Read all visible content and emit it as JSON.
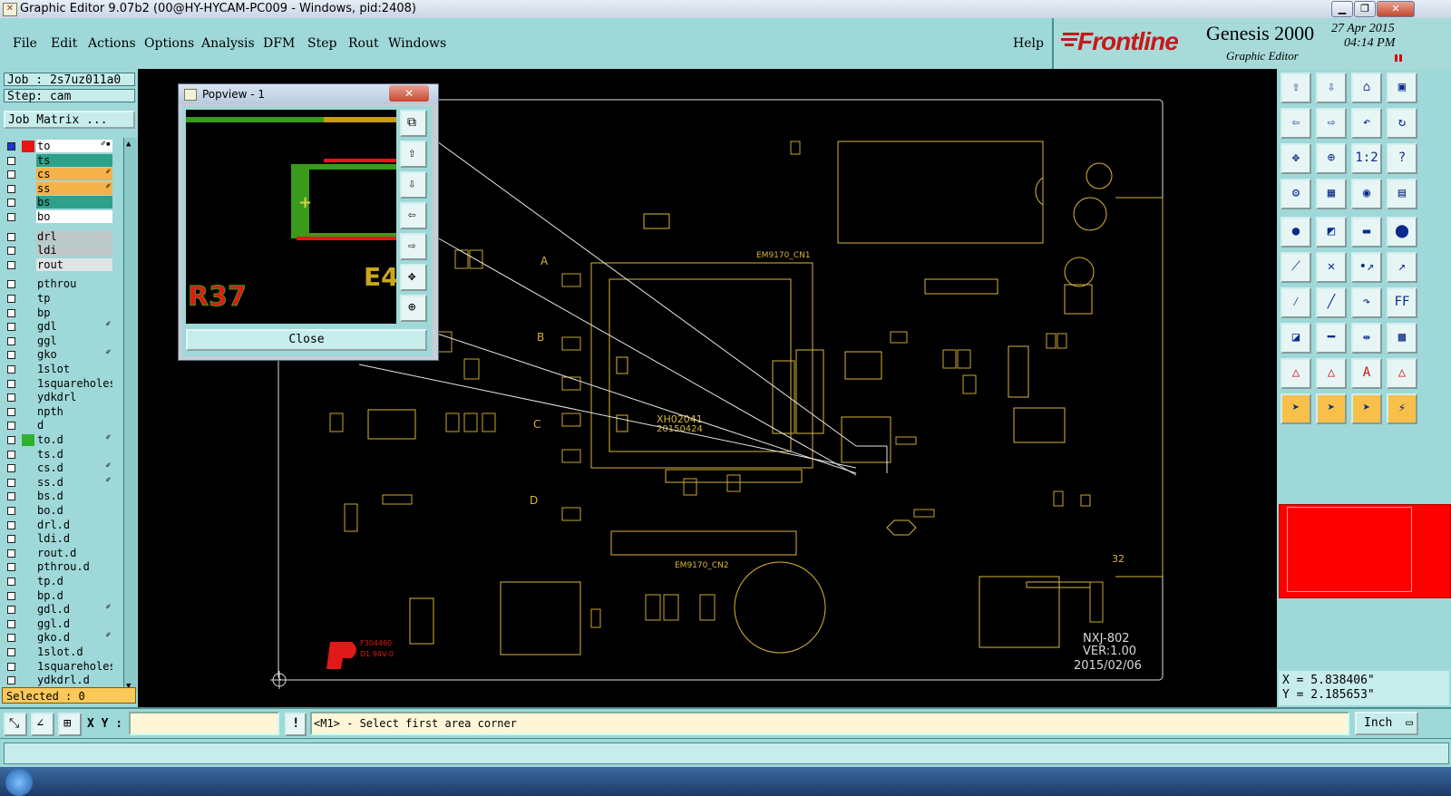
{
  "window": {
    "title": "Graphic Editor 9.07b2 (00@HY-HYCAM-PC009 - Windows, pid:2408)",
    "minimize": "▁",
    "maximize": "❐",
    "close": "✕"
  },
  "menu": {
    "items": [
      "File",
      "Edit",
      "Actions",
      "Options",
      "Analysis",
      "DFM",
      "Step",
      "Rout",
      "Windows"
    ],
    "help": "Help"
  },
  "brand": {
    "logo": "Frontline",
    "product": "Genesis 2000",
    "subtitle": "Graphic Editor",
    "date": "27 Apr 2015",
    "time": "04:14 PM",
    "logo_color": "#c41a1a"
  },
  "job": {
    "job_label": "Job : 2s7uz011a0",
    "step_label": "Step: cam",
    "matrix_button": "Job Matrix ..."
  },
  "layers": [
    {
      "name": "to",
      "color": "#ffffff",
      "mark": "✐▪"
    },
    {
      "name": "ts",
      "color": "#2ea18a",
      "mark": ""
    },
    {
      "name": "cs",
      "color": "#f6b24a",
      "mark": "✐"
    },
    {
      "name": "ss",
      "color": "#f6b24a",
      "mark": "✐"
    },
    {
      "name": "bs",
      "color": "#2ea18a",
      "mark": ""
    },
    {
      "name": "bo",
      "color": "#ffffff",
      "mark": ""
    },
    {
      "name": "drl",
      "color": "#bfc8c8",
      "mark": ""
    },
    {
      "name": "ldi",
      "color": "#bfc8c8",
      "mark": ""
    },
    {
      "name": "rout",
      "color": "#dfe4e4",
      "mark": ""
    },
    {
      "name": "pthrou",
      "color": "#9fd8d8",
      "mark": ""
    },
    {
      "name": "tp",
      "color": "#9fd8d8",
      "mark": ""
    },
    {
      "name": "bp",
      "color": "#9fd8d8",
      "mark": ""
    },
    {
      "name": "gdl",
      "color": "#9fd8d8",
      "mark": "✐"
    },
    {
      "name": "ggl",
      "color": "#9fd8d8",
      "mark": ""
    },
    {
      "name": "gko",
      "color": "#9fd8d8",
      "mark": "✐"
    },
    {
      "name": "1slot",
      "color": "#9fd8d8",
      "mark": ""
    },
    {
      "name": "1squareholes",
      "color": "#9fd8d8",
      "mark": ""
    },
    {
      "name": "ydkdrl",
      "color": "#9fd8d8",
      "mark": ""
    },
    {
      "name": "npth",
      "color": "#9fd8d8",
      "mark": ""
    },
    {
      "name": "d",
      "color": "#9fd8d8",
      "mark": ""
    },
    {
      "name": "to.d",
      "color": "#9fd8d8",
      "mark": "✐"
    },
    {
      "name": "ts.d",
      "color": "#9fd8d8",
      "mark": ""
    },
    {
      "name": "cs.d",
      "color": "#9fd8d8",
      "mark": "✐"
    },
    {
      "name": "ss.d",
      "color": "#9fd8d8",
      "mark": "✐"
    },
    {
      "name": "bs.d",
      "color": "#9fd8d8",
      "mark": ""
    },
    {
      "name": "bo.d",
      "color": "#9fd8d8",
      "mark": ""
    },
    {
      "name": "drl.d",
      "color": "#9fd8d8",
      "mark": ""
    },
    {
      "name": "ldi.d",
      "color": "#9fd8d8",
      "mark": ""
    },
    {
      "name": "rout.d",
      "color": "#9fd8d8",
      "mark": ""
    },
    {
      "name": "pthrou.d",
      "color": "#9fd8d8",
      "mark": ""
    },
    {
      "name": "tp.d",
      "color": "#9fd8d8",
      "mark": ""
    },
    {
      "name": "bp.d",
      "color": "#9fd8d8",
      "mark": ""
    },
    {
      "name": "gdl.d",
      "color": "#9fd8d8",
      "mark": "✐"
    },
    {
      "name": "ggl.d",
      "color": "#9fd8d8",
      "mark": ""
    },
    {
      "name": "gko.d",
      "color": "#9fd8d8",
      "mark": "✐"
    },
    {
      "name": "1slot.d",
      "color": "#9fd8d8",
      "mark": ""
    },
    {
      "name": "1squareholes",
      "color": "#9fd8d8",
      "mark": ""
    },
    {
      "name": "ydkdrl.d",
      "color": "#9fd8d8",
      "mark": ""
    }
  ],
  "selected_label": "Selected : 0",
  "popview": {
    "title": "Popview - 1",
    "ref_label": "R37",
    "ref_label2": "E4",
    "close_button": "Close"
  },
  "board": {
    "name_line1": "NXJ-802",
    "name_line2": "VER:1.00",
    "date_line": "2015/02/06",
    "chip_label1": "XH02041",
    "chip_label2": "20150424",
    "connector1": "EM9170_CN1",
    "connector2": "EM9170_CN2",
    "edge_number": "32",
    "silk_color": "#d9b53a",
    "fiducial_text1": "F304460",
    "fiducial_text2": "D1 94V-0",
    "row_labels": [
      "A",
      "B",
      "C",
      "D"
    ]
  },
  "coords": {
    "x": "X = 5.838406\"",
    "y": "Y = 2.185653\""
  },
  "command": {
    "xy_label": "X Y :",
    "xy_value": "",
    "prompt": "<M1> - Select first area corner",
    "units": "Inch"
  },
  "toolbar_icons": [
    "move-up-icon",
    "move-down-icon",
    "home-icon",
    "window-icon",
    "move-left-icon",
    "move-right-icon",
    "undo-view-icon",
    "redraw-icon",
    "zoom-fit-icon",
    "zoom-area-icon",
    "scale-1-2-icon",
    "help-icon",
    "measure-icon",
    "grid-icon",
    "snap-icon",
    "layers-icon",
    "pad-icon",
    "feature-select-icon",
    "ruler-icon",
    "circle-pad-icon",
    "connect-icon",
    "cross-icon",
    "point-icon",
    "point-to-icon",
    "line-icon",
    "line-diag-icon",
    "arc-icon",
    "text-ff-icon",
    "net-icon",
    "bar-icon",
    "stretch-icon",
    "component-icon",
    "tri-a-icon",
    "tri-b-icon",
    "tri-c-icon",
    "tri-d-icon",
    "select-arrow-icon",
    "select-box-icon",
    "select-poly-icon",
    "select-net-icon"
  ]
}
